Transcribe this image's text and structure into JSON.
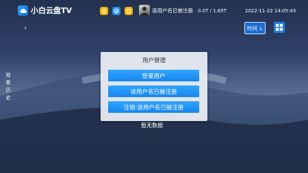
{
  "app": {
    "title": "小白云盘TV"
  },
  "topbar": {
    "account_name": "该用户名已被注册",
    "storage": "0.0T / 1.65T",
    "datetime": "2022-11-22 14:05:43",
    "icons": [
      "settings-icon",
      "info-icon",
      "help-icon"
    ]
  },
  "sidebar": {
    "history_label": "观看历史"
  },
  "toolbar": {
    "tiny_label": "t",
    "sort_label": "时间",
    "sort_arrow": "↓"
  },
  "dialog": {
    "title": "用户管理",
    "buttons": [
      {
        "label": "登录用户"
      },
      {
        "label": "该用户名已被注册"
      },
      {
        "label": "注销:该用户名已被注册"
      }
    ]
  },
  "content": {
    "empty_text": "暂无数据"
  },
  "colors": {
    "accent": "#1e88f0",
    "dialog_bg": "#eceff5",
    "icon_yellow": "#f5b400",
    "icon_blue": "#2a8ef0"
  }
}
